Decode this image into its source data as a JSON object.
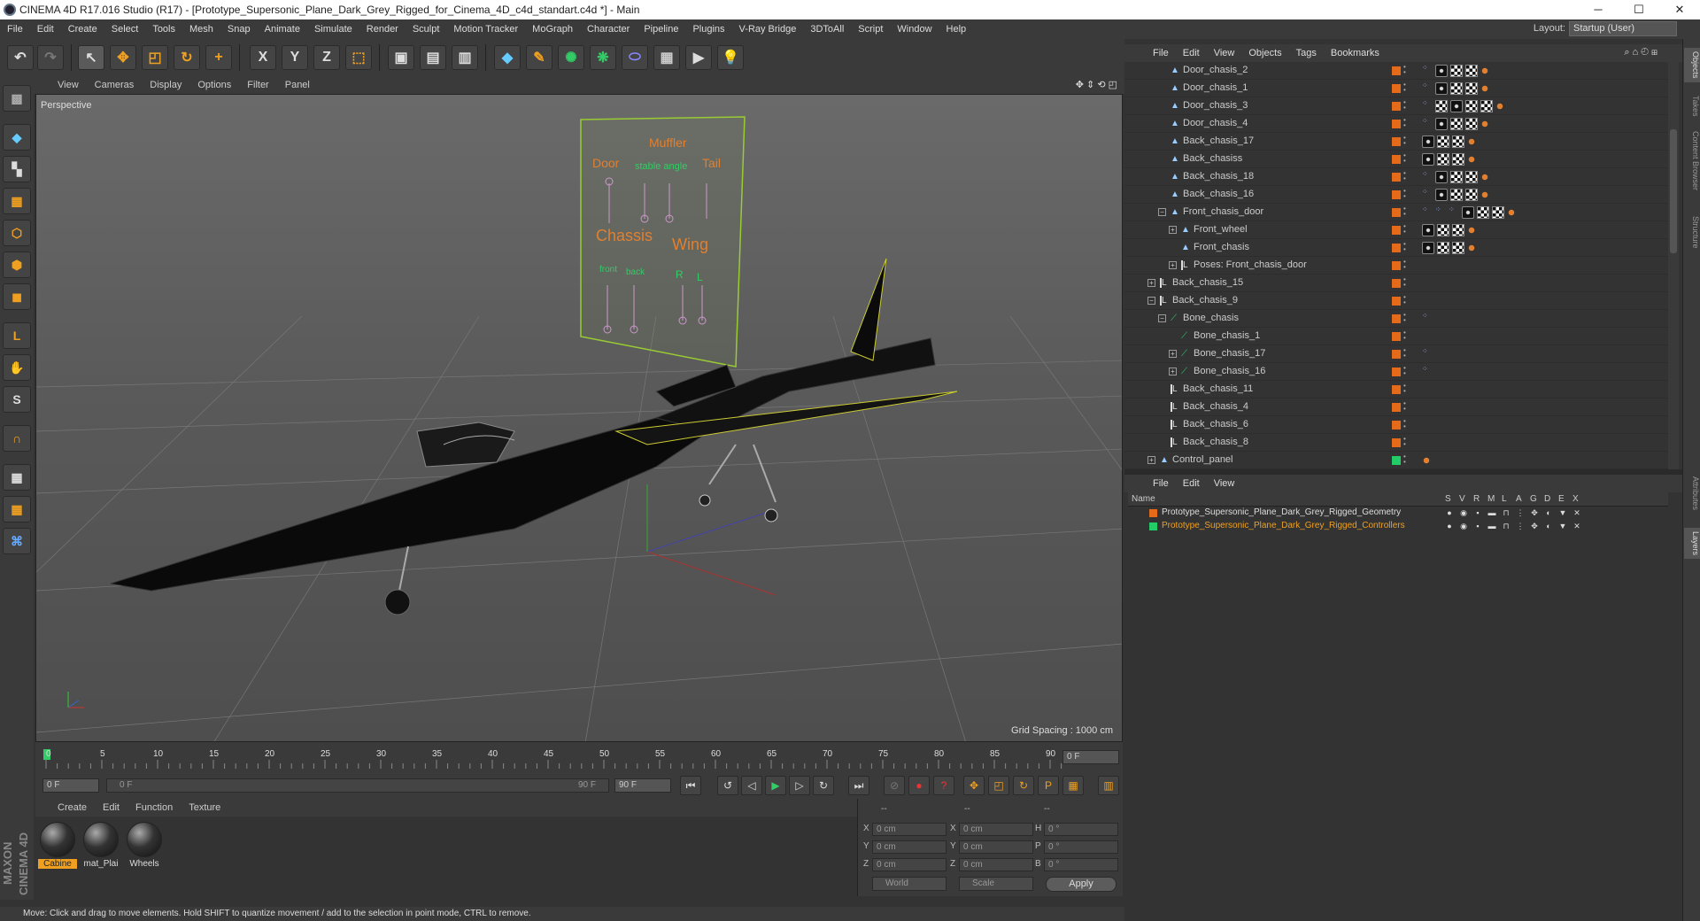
{
  "window": {
    "title": "CINEMA 4D R17.016 Studio (R17) - [Prototype_Supersonic_Plane_Dark_Grey_Rigged_for_Cinema_4D_c4d_standart.c4d *] - Main",
    "minimize": "─",
    "maximize": "☐",
    "close": "✕"
  },
  "menu": [
    "File",
    "Edit",
    "Create",
    "Select",
    "Tools",
    "Mesh",
    "Snap",
    "Animate",
    "Simulate",
    "Render",
    "Sculpt",
    "Motion Tracker",
    "MoGraph",
    "Character",
    "Pipeline",
    "Plugins",
    "V-Ray Bridge",
    "3DToAll",
    "Script",
    "Window",
    "Help"
  ],
  "layout": {
    "label": "Layout:",
    "value": "Startup (User)"
  },
  "toolbar": {
    "undo": "↶",
    "redo": "↷",
    "select": "↖",
    "move": "✥",
    "scale": "◰",
    "rotate": "↻",
    "plus": "+",
    "x": "X",
    "y": "Y",
    "z": "Z",
    "coord": "⬚",
    "render1": "▣",
    "render2": "▤",
    "render3": "▥",
    "cube": "◆",
    "pen": "✎",
    "gen": "✺",
    "deform": "❋",
    "env": "⬭",
    "grid": "▦",
    "cam": "▶",
    "light": "💡"
  },
  "viewport": {
    "menu": [
      "View",
      "Cameras",
      "Display",
      "Options",
      "Filter",
      "Panel"
    ],
    "label": "Perspective",
    "grid_spacing": "Grid Spacing : 1000 cm",
    "panel_labels": {
      "muffler": "Muffler",
      "door": "Door",
      "stable_angle": "stable angle",
      "tail": "Tail",
      "chassis": "Chassis",
      "wing": "Wing",
      "front": "front",
      "back": "back",
      "r": "R",
      "l": "L"
    }
  },
  "timeline": {
    "ticks": [
      "0",
      "5",
      "10",
      "15",
      "20",
      "25",
      "30",
      "35",
      "40",
      "45",
      "50",
      "55",
      "60",
      "65",
      "70",
      "75",
      "80",
      "85",
      "90"
    ],
    "current_frame_field": "0 F",
    "start_field": "0 F",
    "range_start": "0 F",
    "range_end": "90 F",
    "end_field": "90 F"
  },
  "materials": {
    "menu": [
      "Create",
      "Edit",
      "Function",
      "Texture"
    ],
    "items": [
      {
        "name": "Cabine",
        "selected": true
      },
      {
        "name": "mat_Plai",
        "selected": false
      },
      {
        "name": "Wheels",
        "selected": false
      }
    ]
  },
  "coordinates": {
    "headers": [
      "--",
      "--",
      "--"
    ],
    "rows": [
      {
        "a": "X",
        "av": "0 cm",
        "b": "X",
        "bv": "0 cm",
        "c": "H",
        "cv": "0 °"
      },
      {
        "a": "Y",
        "av": "0 cm",
        "b": "Y",
        "bv": "0 cm",
        "c": "P",
        "cv": "0 °"
      },
      {
        "a": "Z",
        "av": "0 cm",
        "b": "Z",
        "bv": "0 cm",
        "c": "B",
        "cv": "0 °"
      }
    ],
    "world": "World",
    "scale": "Scale",
    "apply": "Apply"
  },
  "status": "Move: Click and drag to move elements. Hold SHIFT to quantize movement / add to the selection in point mode, CTRL to remove.",
  "maxon": "MAXON CINEMA 4D",
  "object_manager": {
    "menu": [
      "File",
      "Edit",
      "View",
      "Objects",
      "Tags",
      "Bookmarks"
    ],
    "rows": [
      {
        "name": "Door_chasis_2",
        "indent": 2,
        "icon": "bone",
        "plus": false,
        "tags": [
          "b",
          "k",
          "c",
          "c",
          "o"
        ]
      },
      {
        "name": "Door_chasis_1",
        "indent": 2,
        "icon": "bone",
        "plus": false,
        "tags": [
          "b",
          "k",
          "c",
          "c",
          "o"
        ]
      },
      {
        "name": "Door_chasis_3",
        "indent": 2,
        "icon": "bone",
        "plus": false,
        "tags": [
          "b",
          "c",
          "k",
          "c",
          "c",
          "o"
        ]
      },
      {
        "name": "Door_chasis_4",
        "indent": 2,
        "icon": "bone",
        "plus": false,
        "tags": [
          "b",
          "k",
          "c",
          "c",
          "o"
        ]
      },
      {
        "name": "Back_chasis_17",
        "indent": 2,
        "icon": "bone",
        "plus": false,
        "tags": [
          "k",
          "c",
          "c",
          "o"
        ]
      },
      {
        "name": "Back_chasiss",
        "indent": 2,
        "icon": "bone",
        "plus": false,
        "tags": [
          "k",
          "c",
          "c",
          "o"
        ]
      },
      {
        "name": "Back_chasis_18",
        "indent": 2,
        "icon": "bone",
        "plus": false,
        "tags": [
          "b",
          "k",
          "c",
          "c",
          "o"
        ]
      },
      {
        "name": "Back_chasis_16",
        "indent": 2,
        "icon": "bone",
        "plus": false,
        "tags": [
          "b",
          "k",
          "c",
          "c",
          "o"
        ]
      },
      {
        "name": "Front_chasis_door",
        "indent": 2,
        "icon": "bone",
        "plus": true,
        "tags": [
          "b",
          "b",
          "b",
          "k",
          "c",
          "c",
          "o"
        ]
      },
      {
        "name": "Front_wheel",
        "indent": 3,
        "icon": "bone",
        "plus": true,
        "tags": [
          "k",
          "c",
          "c",
          "o"
        ]
      },
      {
        "name": "Front_chasis",
        "indent": 3,
        "icon": "bone",
        "plus": false,
        "tags": [
          "k",
          "c",
          "c",
          "o"
        ]
      },
      {
        "name": "Poses: Front_chasis_door",
        "indent": 3,
        "icon": "null",
        "plus": true,
        "tags": []
      },
      {
        "name": "Back_chasis_15",
        "indent": 1,
        "icon": "null",
        "plus": true,
        "tags": []
      },
      {
        "name": "Back_chasis_9",
        "indent": 1,
        "icon": "null",
        "plus": true,
        "tags": []
      },
      {
        "name": "Bone_chasis",
        "indent": 2,
        "icon": "joint",
        "plus": true,
        "tags": [
          "b"
        ]
      },
      {
        "name": "Bone_chasis_1",
        "indent": 3,
        "icon": "joint",
        "plus": false,
        "tags": []
      },
      {
        "name": "Bone_chasis_17",
        "indent": 3,
        "icon": "joint",
        "plus": true,
        "tags": [
          "b"
        ]
      },
      {
        "name": "Bone_chasis_16",
        "indent": 3,
        "icon": "joint",
        "plus": true,
        "tags": [
          "b"
        ]
      },
      {
        "name": "Back_chasis_11",
        "indent": 2,
        "icon": "null",
        "plus": false,
        "tags": []
      },
      {
        "name": "Back_chasis_4",
        "indent": 2,
        "icon": "null",
        "plus": false,
        "tags": []
      },
      {
        "name": "Back_chasis_6",
        "indent": 2,
        "icon": "null",
        "plus": false,
        "tags": []
      },
      {
        "name": "Back_chasis_8",
        "indent": 2,
        "icon": "null",
        "plus": false,
        "tags": []
      },
      {
        "name": "Control_panel",
        "indent": 1,
        "icon": "bone",
        "plus": true,
        "tags": [
          "o"
        ]
      }
    ]
  },
  "layers": {
    "menu": [
      "File",
      "Edit",
      "View"
    ],
    "header": {
      "name": "Name",
      "cols": [
        "S",
        "V",
        "R",
        "M",
        "L",
        "A",
        "G",
        "D",
        "E",
        "X"
      ]
    },
    "rows": [
      {
        "name": "Prototype_Supersonic_Plane_Dark_Grey_Rigged_Geometry",
        "color": "#e56a1a",
        "text_color": "#dddddd"
      },
      {
        "name": "Prototype_Supersonic_Plane_Dark_Grey_Rigged_Controllers",
        "color": "#22cc66",
        "text_color": "#f0a020"
      }
    ]
  },
  "right_tabs": [
    "Objects",
    "Takes",
    "Content Browser",
    "Structure",
    "Attributes",
    "Layers"
  ]
}
